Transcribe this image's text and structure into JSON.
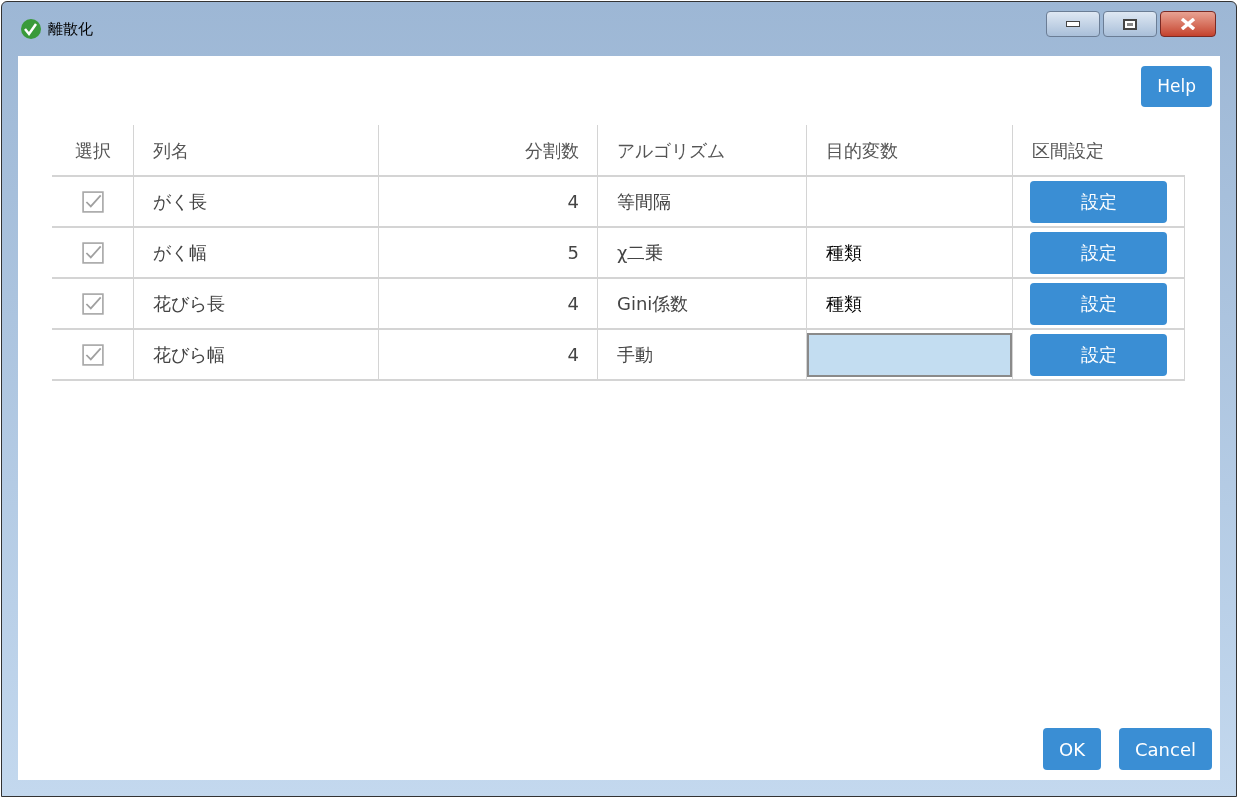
{
  "window": {
    "title": "離散化"
  },
  "help_button": "Help",
  "table": {
    "columns": [
      "選択",
      "列名",
      "分割数",
      "アルゴリズム",
      "目的変数",
      "区間設定"
    ],
    "rows": [
      {
        "checked": true,
        "name": "がく長",
        "bins": "4",
        "algorithm": "等間隔",
        "target": "",
        "target_selected": false,
        "action": "設定"
      },
      {
        "checked": true,
        "name": "がく幅",
        "bins": "5",
        "algorithm": "χ二乗",
        "target": "種類",
        "target_selected": false,
        "action": "設定"
      },
      {
        "checked": true,
        "name": "花びら長",
        "bins": "4",
        "algorithm": "Gini係数",
        "target": "種類",
        "target_selected": false,
        "action": "設定"
      },
      {
        "checked": true,
        "name": "花びら幅",
        "bins": "4",
        "algorithm": "手動",
        "target": "",
        "target_selected": true,
        "action": "設定"
      }
    ]
  },
  "buttons": [
    "OK",
    "Cancel"
  ]
}
